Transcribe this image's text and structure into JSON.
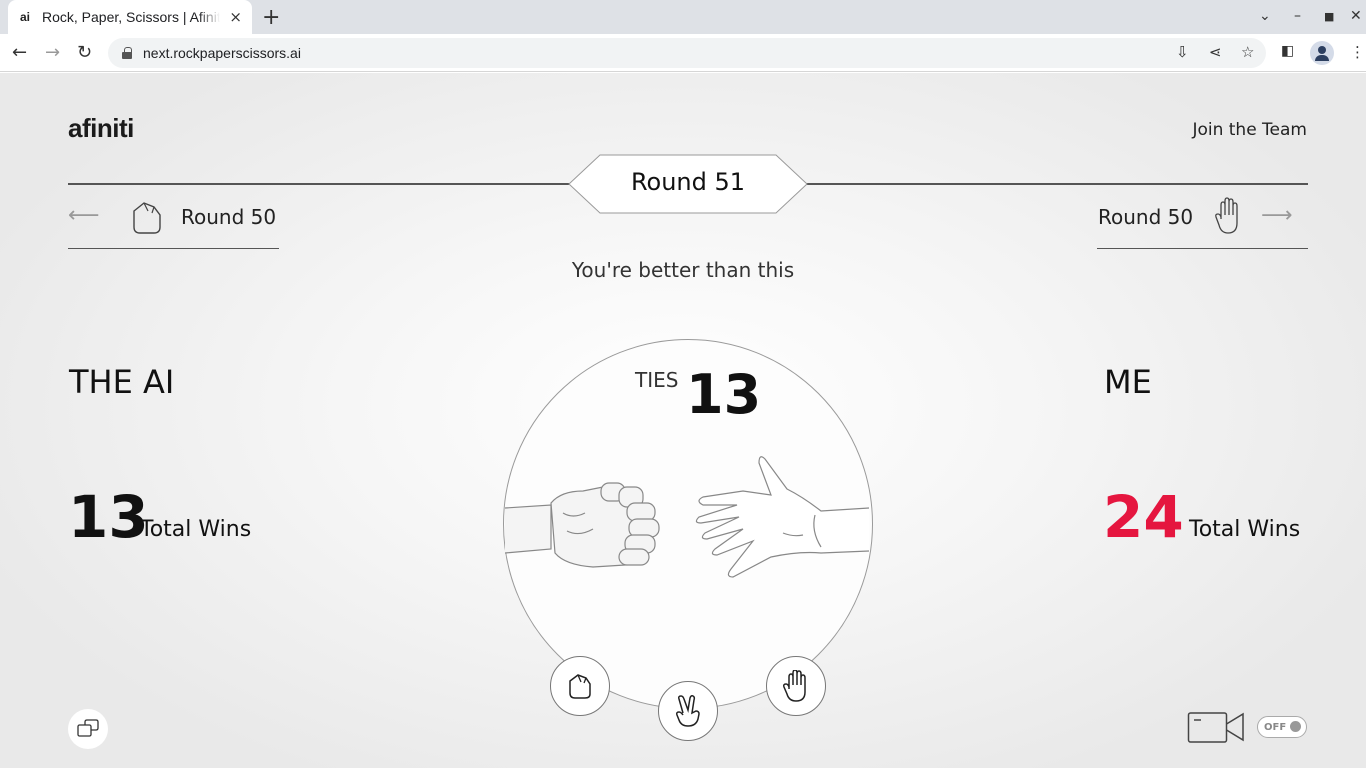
{
  "browser": {
    "tab_favicon": "ai",
    "tab_title": "Rock, Paper, Scissors | Afiniti",
    "tab_close": "×",
    "new_tab": "+",
    "url": "next.rockpaperscissors.ai",
    "icons": [
      "back-icon",
      "forward-icon",
      "reload-icon",
      "lock-icon",
      "install-icon",
      "share-icon",
      "star-icon",
      "side-panel-icon",
      "profile-icon",
      "menu-icon"
    ]
  },
  "header": {
    "logo": "afiniti",
    "join_link": "Join the Team"
  },
  "round": {
    "current": "Round 51",
    "previous_ai": "Round 50",
    "previous_me": "Round 50",
    "message": "You're better than this"
  },
  "ai": {
    "title": "THE AI",
    "wins": "13",
    "wins_label": "Total Wins"
  },
  "me": {
    "title": "ME",
    "wins": "24",
    "wins_label": "Total Wins"
  },
  "ties": {
    "label": "TIES",
    "count": "13"
  },
  "moves": [
    "rock",
    "scissors",
    "paper"
  ],
  "camera_toggle": "OFF",
  "colors": {
    "accent": "#e5163f",
    "text": "#111111",
    "line": "#555555"
  }
}
